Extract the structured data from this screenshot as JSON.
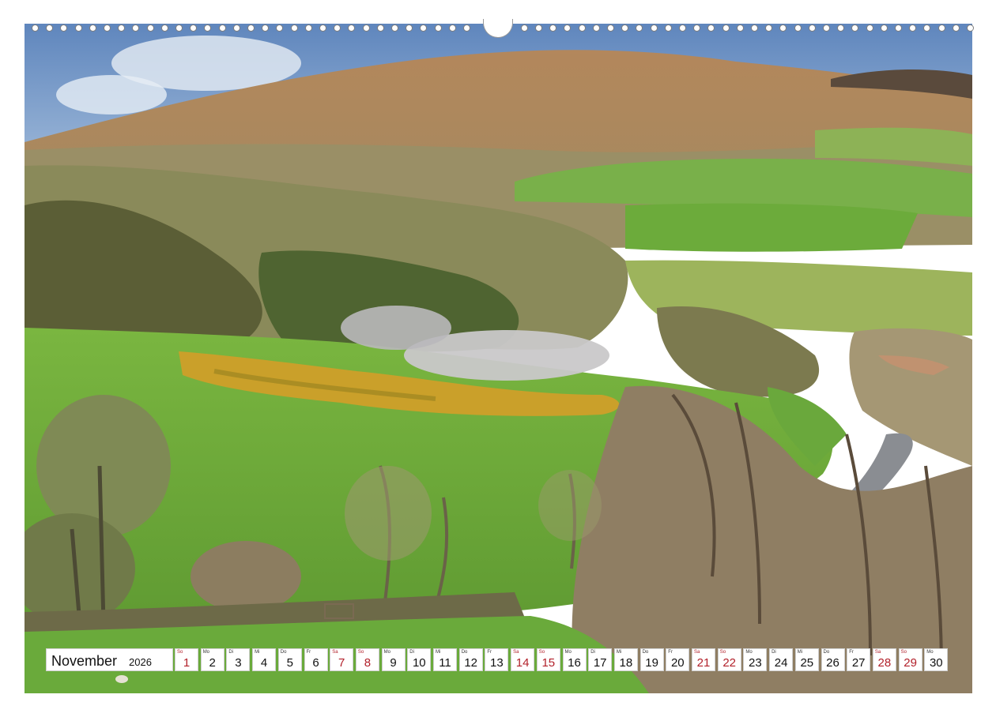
{
  "calendar": {
    "month": "November",
    "year": "2026",
    "days": [
      {
        "dow": "So",
        "num": "1",
        "weekend": true
      },
      {
        "dow": "Mo",
        "num": "2",
        "weekend": false
      },
      {
        "dow": "Di",
        "num": "3",
        "weekend": false
      },
      {
        "dow": "Mi",
        "num": "4",
        "weekend": false
      },
      {
        "dow": "Do",
        "num": "5",
        "weekend": false
      },
      {
        "dow": "Fr",
        "num": "6",
        "weekend": false
      },
      {
        "dow": "Sa",
        "num": "7",
        "weekend": true
      },
      {
        "dow": "So",
        "num": "8",
        "weekend": true
      },
      {
        "dow": "Mo",
        "num": "9",
        "weekend": false
      },
      {
        "dow": "Di",
        "num": "10",
        "weekend": false
      },
      {
        "dow": "Mi",
        "num": "11",
        "weekend": false
      },
      {
        "dow": "Do",
        "num": "12",
        "weekend": false
      },
      {
        "dow": "Fr",
        "num": "13",
        "weekend": false
      },
      {
        "dow": "Sa",
        "num": "14",
        "weekend": true
      },
      {
        "dow": "So",
        "num": "15",
        "weekend": true
      },
      {
        "dow": "Mo",
        "num": "16",
        "weekend": false
      },
      {
        "dow": "Di",
        "num": "17",
        "weekend": false
      },
      {
        "dow": "Mi",
        "num": "18",
        "weekend": false
      },
      {
        "dow": "Do",
        "num": "19",
        "weekend": false
      },
      {
        "dow": "Fr",
        "num": "20",
        "weekend": false
      },
      {
        "dow": "Sa",
        "num": "21",
        "weekend": true
      },
      {
        "dow": "So",
        "num": "22",
        "weekend": true
      },
      {
        "dow": "Mo",
        "num": "23",
        "weekend": false
      },
      {
        "dow": "Di",
        "num": "24",
        "weekend": false
      },
      {
        "dow": "Mi",
        "num": "25",
        "weekend": false
      },
      {
        "dow": "Do",
        "num": "26",
        "weekend": false
      },
      {
        "dow": "Fr",
        "num": "27",
        "weekend": false
      },
      {
        "dow": "Sa",
        "num": "28",
        "weekend": true
      },
      {
        "dow": "So",
        "num": "29",
        "weekend": true
      },
      {
        "dow": "Mo",
        "num": "30",
        "weekend": false
      }
    ]
  },
  "colors": {
    "weekend": "#b2202a",
    "sky": "#6f95c7",
    "meadow": "#6faa3a",
    "gorse": "#d4a52a"
  }
}
